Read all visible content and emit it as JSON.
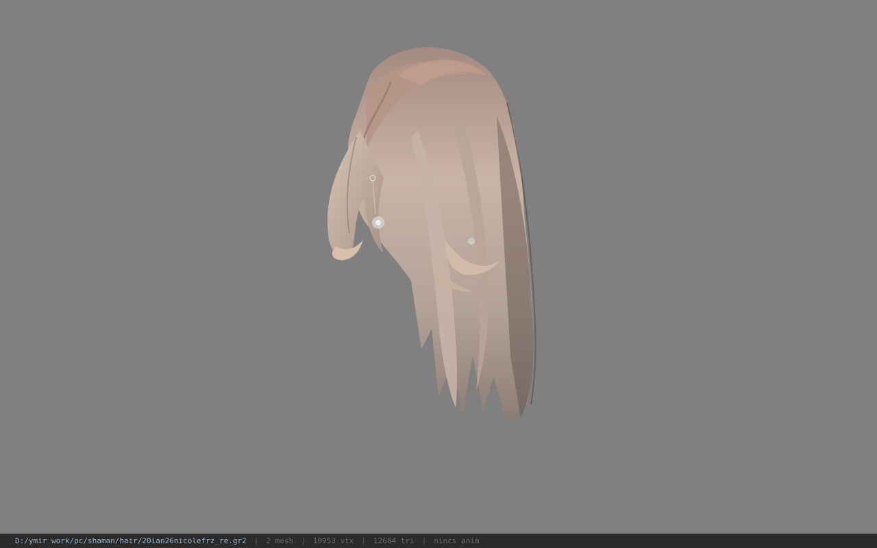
{
  "viewport": {
    "background_color": "#808080",
    "model_icon": "hair-mesh-model"
  },
  "status_bar": {
    "file_path": "D:/ymir work/pc/shaman/hair/20ian26nicolefrz_re.gr2",
    "mesh_count": "2 mesh",
    "vertex_count": "10953 vtx",
    "triangle_count": "12684 tri",
    "anim_status": "nincs anim",
    "separator": "|",
    "path_color": "#8fb3cf",
    "text_color": "#6b6b6b"
  }
}
